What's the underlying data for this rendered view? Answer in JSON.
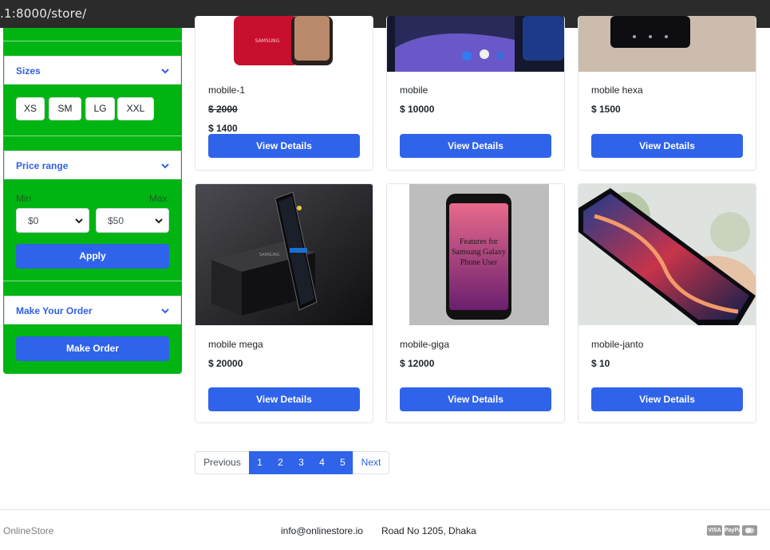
{
  "browser": {
    "url": ".1:8000/store/"
  },
  "sidebar": {
    "sizes_title": "Sizes",
    "sizes": [
      "XS",
      "SM",
      "LG",
      "XXL"
    ],
    "price_title": "Price range",
    "min_label": "Min",
    "max_label": "Max",
    "min_value": "$0",
    "max_value": "$50",
    "apply_label": "Apply",
    "order_title": "Make Your Order",
    "order_label": "Make Order"
  },
  "products": [
    {
      "name": "mobile-1",
      "old_price": "$ 2000",
      "price": "$ 1400",
      "button": "View Details"
    },
    {
      "name": "mobile",
      "price": "$ 10000",
      "button": "View Details"
    },
    {
      "name": "mobile hexa",
      "price": "$ 1500",
      "button": "View Details"
    },
    {
      "name": "mobile mega",
      "price": "$ 20000",
      "button": "View Details"
    },
    {
      "name": "mobile-giga",
      "price": "$ 12000",
      "button": "View Details",
      "image_text": "Features for Samsung Galaxy Phone User"
    },
    {
      "name": "mobile-janto",
      "price": "$ 10",
      "button": "View Details"
    }
  ],
  "pagination": {
    "previous": "Previous",
    "pages": [
      "1",
      "2",
      "3",
      "4",
      "5"
    ],
    "next": "Next"
  },
  "footer": {
    "brand": "OnlineStore",
    "email": "info@onlinestore.io",
    "address": "Road No 1205, Dhaka",
    "payment_icons": [
      "visa-icon",
      "paypal-icon",
      "mastercard-icon"
    ]
  },
  "colors": {
    "sidebar_green": "#00b512",
    "primary_blue": "#2f63e9"
  }
}
